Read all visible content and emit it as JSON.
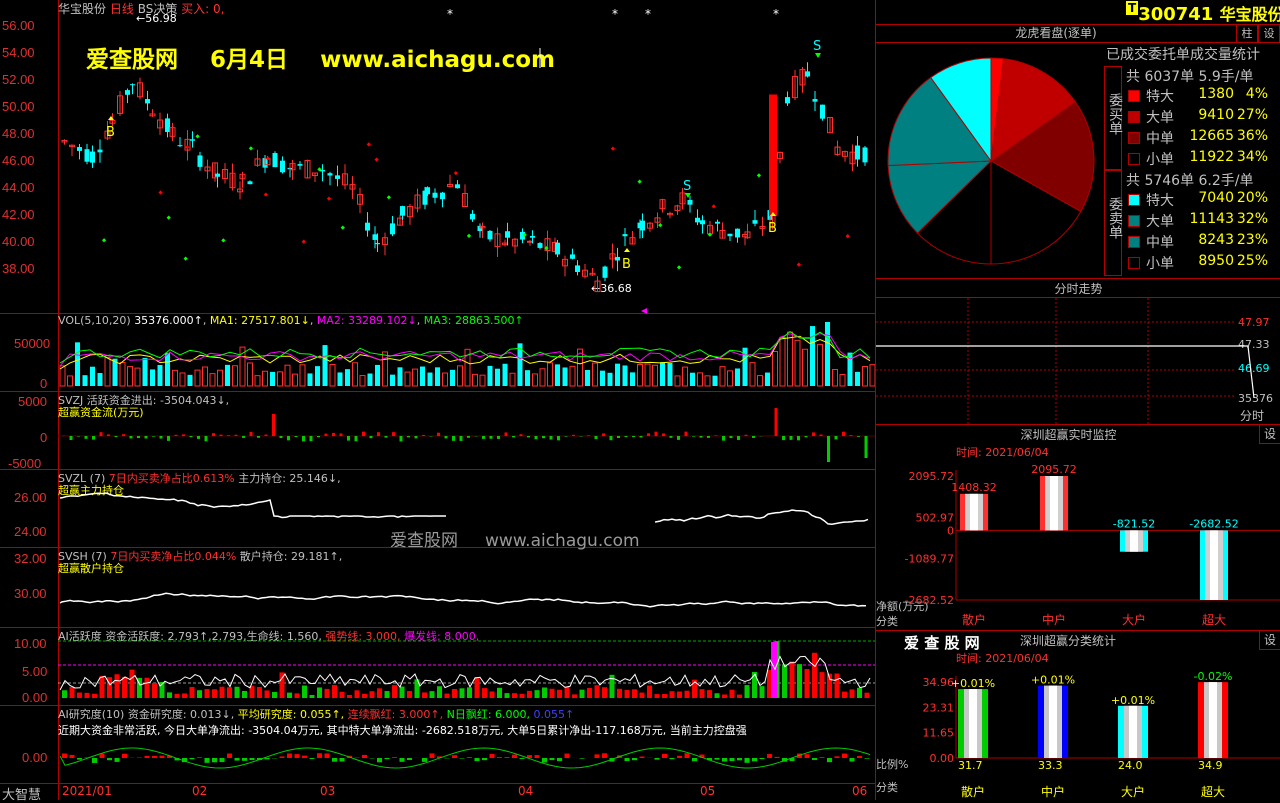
{
  "main": {
    "stock_name": "华宝股份",
    "period": "日线",
    "indicator": "BS决策",
    "buy_label": "买入: 0,",
    "high_mark": "56.98",
    "low_mark": "36.68",
    "watermark": "爱查股网    6月4日    www.aichagu.com",
    "y_ticks": [
      "56.00",
      "54.00",
      "52.00",
      "50.00",
      "48.00",
      "46.00",
      "44.00",
      "42.00",
      "40.00",
      "38.00"
    ],
    "buy_signal": "B",
    "sell_signal": "S",
    "star": "*"
  },
  "vol": {
    "header": "VOL(5,10,20)",
    "value": "35376.000↑",
    "ma1": "MA1: 27517.801↓",
    "ma2": "MA2: 33289.102↓",
    "ma3": "MA3: 28863.500↑",
    "y_ticks": [
      "50000",
      "0"
    ]
  },
  "svzj": {
    "header": "SVZJ  活跃资金进出: -3504.043↓,",
    "sub": "超赢资金流(万元)",
    "y_ticks": [
      "5000",
      "0",
      "-5000"
    ]
  },
  "svzl": {
    "header_left": "SVZL (7)",
    "header_mid": "7日内买卖净占比0.613%",
    "header_right": "主力持仓: 25.146↓,",
    "sub": "超赢主力持仓",
    "y_ticks": [
      "26.00",
      "24.00"
    ],
    "watermark": "爱查股网     www.aichagu.com"
  },
  "svsh": {
    "header_left": "SVSH (7)",
    "header_mid": "7日内买卖净占比0.044%",
    "header_right": "散户持仓: 29.181↑,",
    "sub": "超赢散户持仓",
    "y_ticks": [
      "32.00",
      "30.00"
    ]
  },
  "ai_act": {
    "header": "AI活跃度 资金活跃度: 2.793↑,2.793,生命线: 1.560,",
    "strong": "强势线: 3.000,",
    "burst": "爆发线: 8.000,",
    "y_ticks": [
      "10.00",
      "5.00",
      "0.00"
    ]
  },
  "ai_res": {
    "header": "AI研究度(10) 资金研究度: 0.013↓,",
    "avg": "平均研究度: 0.055↑,",
    "cont": "连续飘红: 3.000↑,",
    "nday": "N日飘红: 6.000,",
    "val": "0.055↑",
    "desc": "近期大资金非常活跃, 今日大单净流出: -3504.04万元, 其中特大单净流出: -2682.518万元, 大单5日累计净出-117.168万元, 当前主力控盘强",
    "y_ticks": [
      "0.00"
    ]
  },
  "xaxis": {
    "labels": [
      "2021/01",
      "02",
      "03",
      "04",
      "05",
      "06"
    ],
    "brand": "大智慧"
  },
  "right": {
    "code": "300741",
    "name": "华宝股份",
    "btn_zhu": "柱",
    "btn_gear": "设",
    "lhkp_title": "龙虎看盘(逐单)",
    "lhkp_sub": "已成交委托单成交量统计",
    "buy_side": "委买单",
    "sell_side": "委卖单",
    "buy_total": "共 6037单 5.9手/单",
    "sell_total": "共 5746单 6.2手/单",
    "buy_rows": [
      {
        "label": "特大",
        "value": "1380",
        "pct": "4%",
        "color": "#ff0000"
      },
      {
        "label": "大单",
        "value": "9410",
        "pct": "27%",
        "color": "#c00000"
      },
      {
        "label": "中单",
        "value": "12665",
        "pct": "36%",
        "color": "#800000"
      },
      {
        "label": "小单",
        "value": "11922",
        "pct": "34%",
        "color": "#000000"
      }
    ],
    "sell_rows": [
      {
        "label": "特大",
        "value": "7040",
        "pct": "20%",
        "color": "#00ffff"
      },
      {
        "label": "大单",
        "value": "11143",
        "pct": "32%",
        "color": "#008080"
      },
      {
        "label": "中单",
        "value": "8243",
        "pct": "23%",
        "color": "#008080"
      },
      {
        "label": "小单",
        "value": "8950",
        "pct": "25%",
        "color": "#000000"
      }
    ],
    "fs_title": "分时走势",
    "fs_ticks": [
      "47.97",
      "47.33",
      "46.69"
    ],
    "fs_vol": "35376",
    "fs_time": "分时",
    "mon_title": "深圳超赢实时监控",
    "mon_time": "时间: 2021/06/04",
    "mon_ticks": [
      "2095.72",
      "502.97",
      "0",
      "-1089.77",
      "-2682.52"
    ],
    "mon_values": [
      {
        "cat": "散户",
        "value": 1408.32,
        "label": "1408.32"
      },
      {
        "cat": "中户",
        "value": 2095.72,
        "label": "2095.72"
      },
      {
        "cat": "大户",
        "value": -821.52,
        "label": "-821.52"
      },
      {
        "cat": "超大",
        "value": -2682.52,
        "label": "-2682.52"
      }
    ],
    "mon_ylabel": "净额(万元)",
    "mon_xlabel": "分类",
    "cls_logo": "爱 查 股 网",
    "cls_title": "深圳超赢分类统计",
    "cls_time": "时间: 2021/06/04",
    "cls_ticks": [
      "34.96",
      "23.31",
      "11.65",
      "0.00"
    ],
    "cls_ylabel": "比例%",
    "cls_xlabel": "分类",
    "cls_values": [
      {
        "cat": "散户",
        "value": 31.7,
        "label": "31.7",
        "delta": "+0.01%",
        "color": "#00cc00"
      },
      {
        "cat": "中户",
        "value": 33.3,
        "label": "33.3",
        "delta": "+0.01%",
        "color": "#0000ff"
      },
      {
        "cat": "大户",
        "value": 24.0,
        "label": "24.0",
        "delta": "+0.01%",
        "color": "#00ffff"
      },
      {
        "cat": "超大",
        "value": 34.9,
        "label": "34.9",
        "delta": "-0.02%",
        "color": "#ff0000"
      }
    ]
  }
}
